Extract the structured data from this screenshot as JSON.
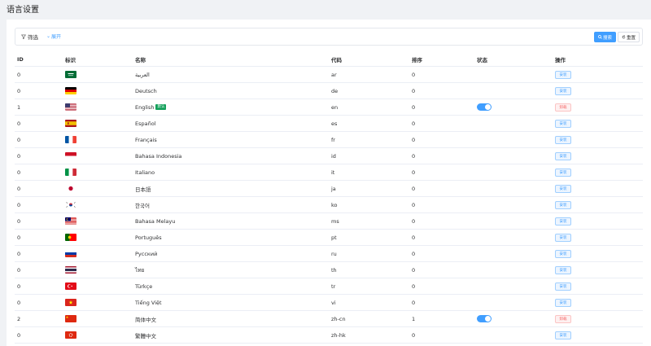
{
  "page": {
    "title": "语言设置"
  },
  "filter": {
    "filter_label": "筛选",
    "expand_label": "展开",
    "search_label": "搜索",
    "reset_label": "重置"
  },
  "table": {
    "headers": {
      "id": "ID",
      "flag": "标识",
      "name": "名称",
      "code": "代码",
      "sort": "排序",
      "status": "状态",
      "op": "操作"
    },
    "rows": [
      {
        "id": "0",
        "flag": "sa",
        "name": "العربية",
        "code": "ar",
        "sort": "0",
        "enabled": false,
        "action": "安装"
      },
      {
        "id": "0",
        "flag": "de",
        "name": "Deutsch",
        "code": "de",
        "sort": "0",
        "enabled": false,
        "action": "安装"
      },
      {
        "id": "1",
        "flag": "us",
        "name": "English",
        "badge": "默认",
        "code": "en",
        "sort": "0",
        "enabled": true,
        "action": "卸载"
      },
      {
        "id": "0",
        "flag": "es",
        "name": "Español",
        "code": "es",
        "sort": "0",
        "enabled": false,
        "action": "安装"
      },
      {
        "id": "0",
        "flag": "fr",
        "name": "Français",
        "code": "fr",
        "sort": "0",
        "enabled": false,
        "action": "安装"
      },
      {
        "id": "0",
        "flag": "id",
        "name": "Bahasa Indonesia",
        "code": "id",
        "sort": "0",
        "enabled": false,
        "action": "安装"
      },
      {
        "id": "0",
        "flag": "it",
        "name": "Italiano",
        "code": "it",
        "sort": "0",
        "enabled": false,
        "action": "安装"
      },
      {
        "id": "0",
        "flag": "jp",
        "name": "日本語",
        "code": "ja",
        "sort": "0",
        "enabled": false,
        "action": "安装"
      },
      {
        "id": "0",
        "flag": "kr",
        "name": "한국어",
        "code": "ko",
        "sort": "0",
        "enabled": false,
        "action": "安装"
      },
      {
        "id": "0",
        "flag": "my",
        "name": "Bahasa Melayu",
        "code": "ms",
        "sort": "0",
        "enabled": false,
        "action": "安装"
      },
      {
        "id": "0",
        "flag": "pt",
        "name": "Português",
        "code": "pt",
        "sort": "0",
        "enabled": false,
        "action": "安装"
      },
      {
        "id": "0",
        "flag": "ru",
        "name": "Русский",
        "code": "ru",
        "sort": "0",
        "enabled": false,
        "action": "安装"
      },
      {
        "id": "0",
        "flag": "th",
        "name": "ไทย",
        "code": "th",
        "sort": "0",
        "enabled": false,
        "action": "安装"
      },
      {
        "id": "0",
        "flag": "tr",
        "name": "Türkçe",
        "code": "tr",
        "sort": "0",
        "enabled": false,
        "action": "安装"
      },
      {
        "id": "0",
        "flag": "vn",
        "name": "Tiếng Việt",
        "code": "vi",
        "sort": "0",
        "enabled": false,
        "action": "安装"
      },
      {
        "id": "2",
        "flag": "cn",
        "name": "简体中文",
        "code": "zh-cn",
        "sort": "1",
        "enabled": true,
        "action": "卸载"
      },
      {
        "id": "0",
        "flag": "hk",
        "name": "繁體中文",
        "code": "zh-hk",
        "sort": "0",
        "enabled": false,
        "action": "安装"
      }
    ]
  }
}
